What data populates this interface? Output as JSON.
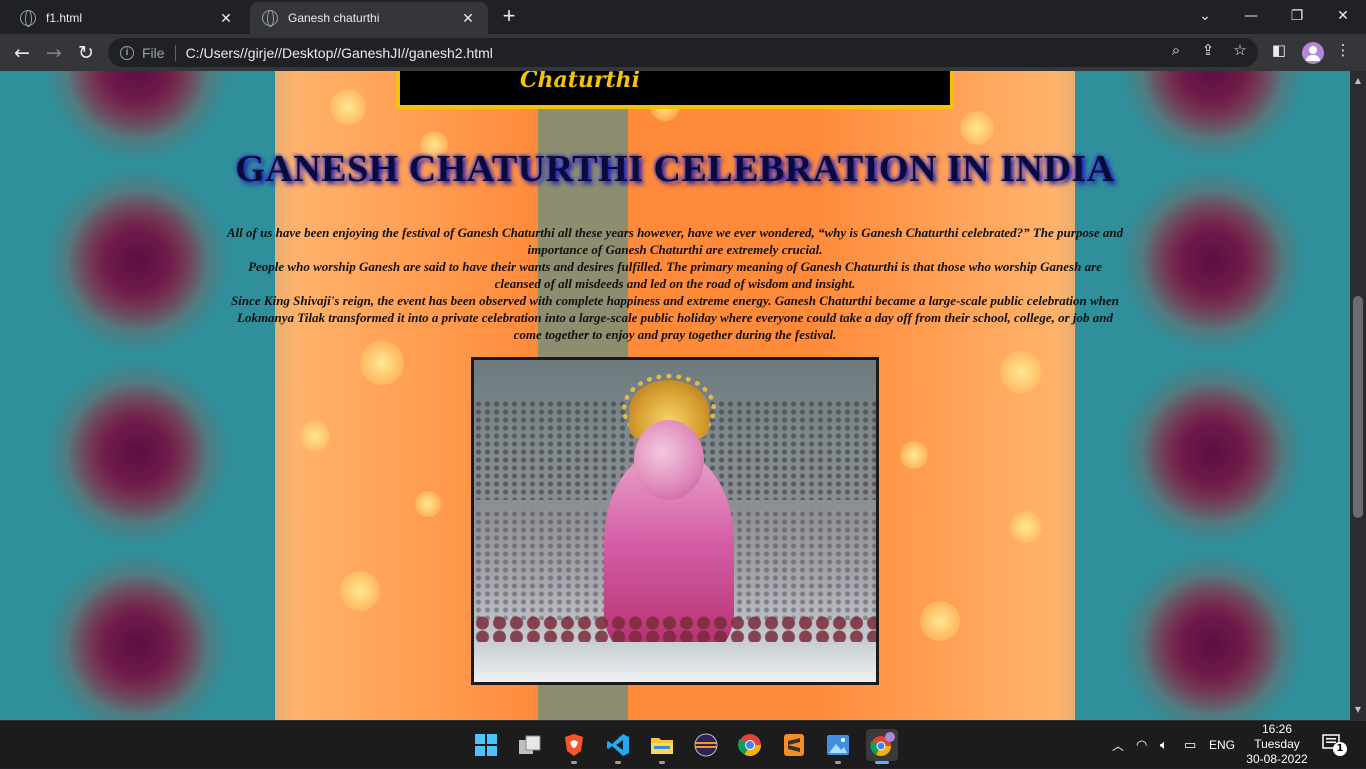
{
  "browser": {
    "tabs": [
      {
        "title": "f1.html",
        "active": false
      },
      {
        "title": "Ganesh chaturthi",
        "active": true
      }
    ],
    "new_tab_icon": "plus-icon",
    "file_label": "File",
    "url": "C:/Users//girje//Desktop//GaneshJI//ganesh2.html"
  },
  "page": {
    "banner_text": "Chaturthi",
    "heading": "GANESH CHATURTHI CELEBRATION IN INDIA",
    "paragraphs": [
      "All of us have been enjoying the festival of Ganesh Chaturthi all these years however, have we ever wondered, “why is Ganesh Chaturthi celebrated?” The purpose and importance of Ganesh Chaturthi are extremely crucial.",
      "People who worship Ganesh are said to have their wants and desires fulfilled. The primary meaning of Ganesh Chaturthi is that those who worship Ganesh are cleansed of all misdeeds and led on the road of wisdom and insight.",
      "Since King Shivaji's reign, the event has been observed with complete happiness and extreme energy. Ganesh Chaturthi became a large-scale public celebration when Lokmanya Tilak transformed it into a private celebration into a large-scale public holiday where everyone could take a day off from their school, college, or job and come together to enjoy and pray together during the festival."
    ],
    "image_alt_icon": "ganesh-idol-photo",
    "colors": {
      "heading": "#0b0b3a",
      "heading_glow": "#1c1cbf",
      "banner_border": "#f4c20d",
      "orange": "#ff8a3a",
      "teal": "#2d9fa7"
    }
  },
  "taskbar": {
    "apps": [
      "windows-start-icon",
      "task-view-icon",
      "brave-icon",
      "vscode-icon",
      "file-explorer-icon",
      "eclipse-icon",
      "chrome-icon",
      "sublime-icon",
      "photos-icon",
      "chrome-profile-icon"
    ],
    "language": "ENG",
    "time": "16:26",
    "day": "Tuesday",
    "date": "30-08-2022",
    "notification_count": "1"
  }
}
